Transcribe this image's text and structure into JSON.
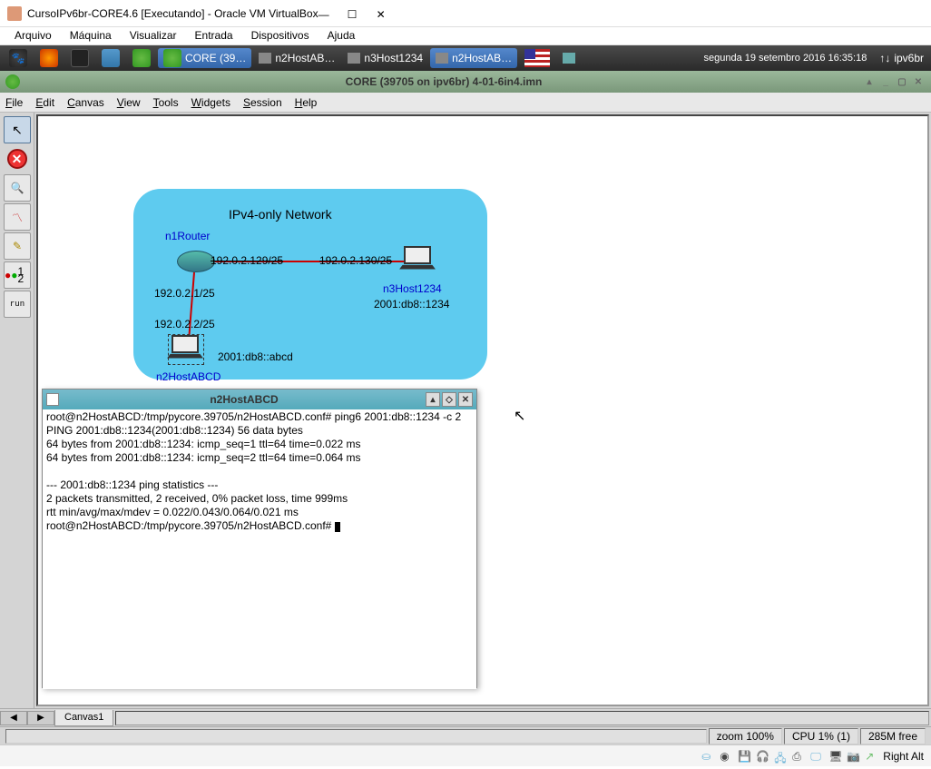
{
  "vb": {
    "title": "CursoIPv6br-CORE4.6 [Executando] - Oracle VM VirtualBox",
    "menu": [
      "Arquivo",
      "Máquina",
      "Visualizar",
      "Entrada",
      "Dispositivos",
      "Ajuda"
    ],
    "status_host": "Right Alt"
  },
  "linux_bar": {
    "tasks": [
      {
        "label": "CORE (39…",
        "icon": "leaf"
      },
      {
        "label": "n2HostAB…",
        "icon": "term"
      },
      {
        "label": "n3Host1234",
        "icon": "term"
      },
      {
        "label": "n2HostAB…",
        "icon": "term",
        "active": true
      }
    ],
    "datetime": "segunda 19 setembro 2016 16:35:18",
    "host": "ipv6br"
  },
  "core": {
    "title": "CORE (39705 on ipv6br) 4-01-6in4.imn",
    "menu": [
      "File",
      "Edit",
      "Canvas",
      "View",
      "Tools",
      "Widgets",
      "Session",
      "Help"
    ],
    "tools": [
      {
        "name": "select",
        "glyph": "↖"
      },
      {
        "name": "stop",
        "glyph": "✕"
      },
      {
        "name": "zoom",
        "glyph": "🔍"
      },
      {
        "name": "chart",
        "glyph": "📈"
      },
      {
        "name": "pencil",
        "glyph": "✎"
      },
      {
        "name": "twonode",
        "glyph": "1 2"
      },
      {
        "name": "run",
        "glyph": "run"
      }
    ],
    "tab": "Canvas1",
    "status": {
      "zoom": "zoom 100%",
      "cpu": "CPU 1% (1)",
      "mem": "285M free"
    }
  },
  "topology": {
    "cloud_title": "IPv4-only Network",
    "nodes": {
      "n1": {
        "label": "n1Router"
      },
      "n2": {
        "label": "n2HostABCD",
        "ipv6": "2001:db8::abcd"
      },
      "n3": {
        "label": "n3Host1234",
        "ipv6": "2001:db8::1234"
      }
    },
    "ips": {
      "r_left": "192.0.2.129/25",
      "r_right": "192.0.2.130/25",
      "down1": "192.0.2.1/25",
      "down2": "192.0.2.2/25"
    }
  },
  "terminal": {
    "title": "n2HostABCD",
    "lines": [
      "root@n2HostABCD:/tmp/pycore.39705/n2HostABCD.conf# ping6 2001:db8::1234 -c 2",
      "PING 2001:db8::1234(2001:db8::1234) 56 data bytes",
      "64 bytes from 2001:db8::1234: icmp_seq=1 ttl=64 time=0.022 ms",
      "64 bytes from 2001:db8::1234: icmp_seq=2 ttl=64 time=0.064 ms",
      "",
      "--- 2001:db8::1234 ping statistics ---",
      "2 packets transmitted, 2 received, 0% packet loss, time 999ms",
      "rtt min/avg/max/mdev = 0.022/0.043/0.064/0.021 ms",
      "root@n2HostABCD:/tmp/pycore.39705/n2HostABCD.conf# "
    ]
  }
}
